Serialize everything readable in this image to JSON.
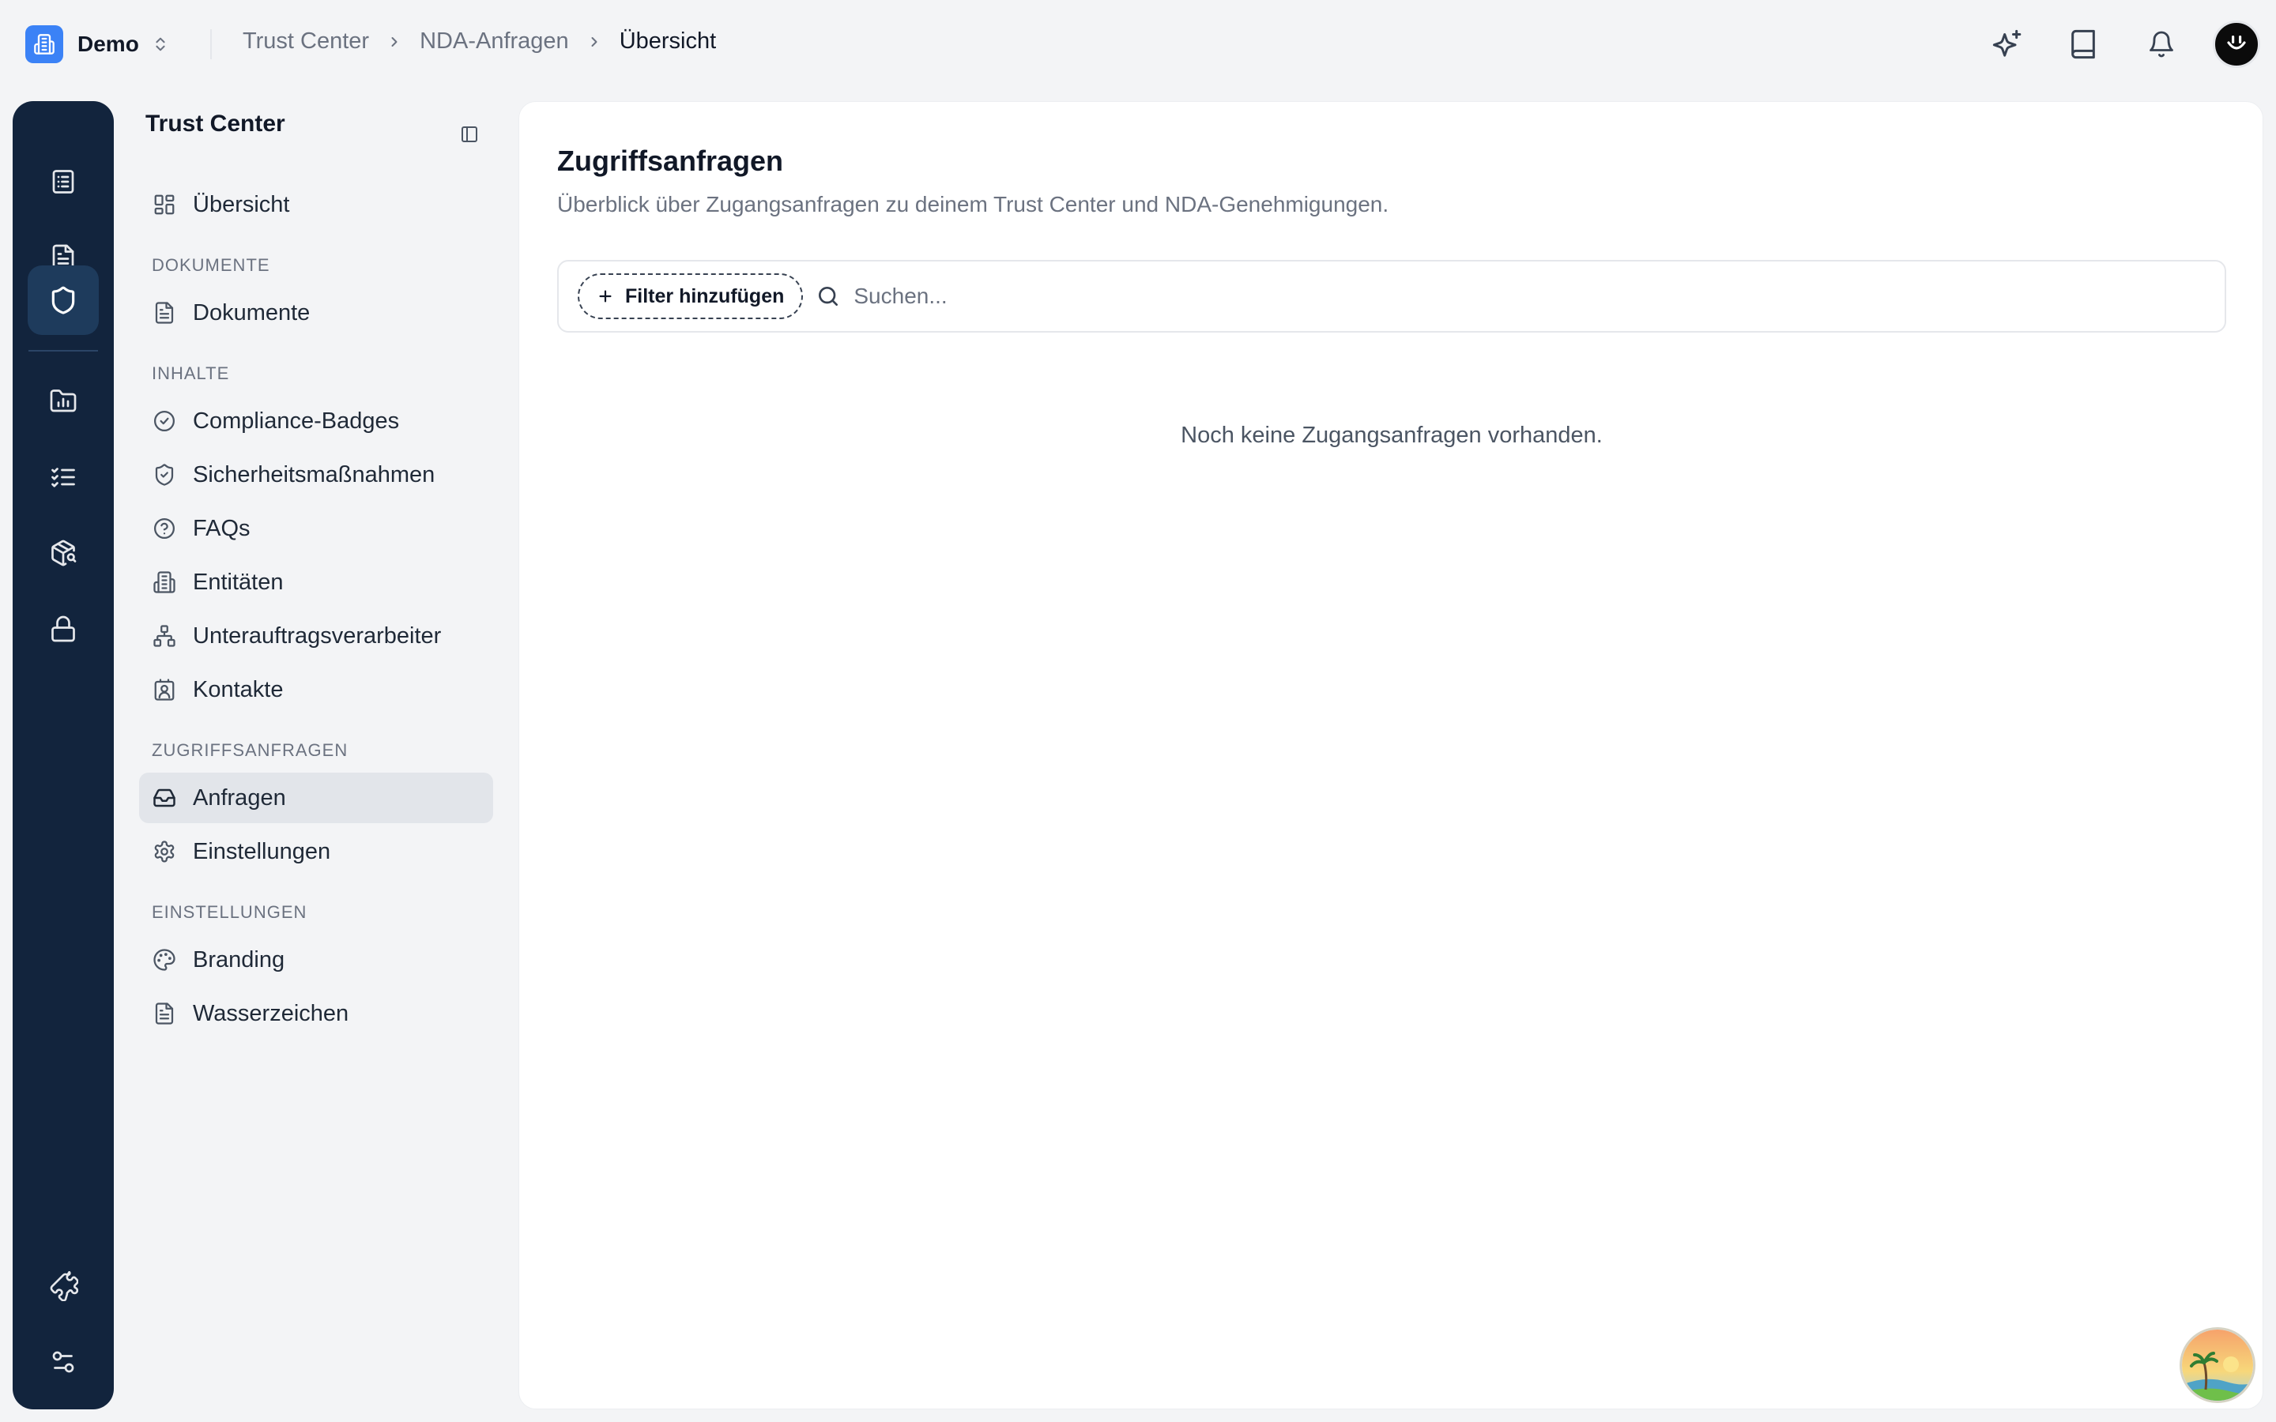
{
  "workspace": {
    "name": "Demo",
    "logo_icon": "building-icon",
    "switch_icon": "chevron-up-down-icon"
  },
  "breadcrumb": {
    "items": [
      "Trust Center",
      "NDA-Anfragen"
    ],
    "current": "Übersicht"
  },
  "topbar_icons": [
    "sparkles-icon",
    "book-icon",
    "bell-icon",
    "avatar"
  ],
  "rail": {
    "items": [
      "checklist-icon",
      "document-icon",
      "shield-icon",
      "chart-folder-icon",
      "tasks-icon",
      "package-search-icon",
      "lock-icon"
    ],
    "active": "shield-icon",
    "bottom_items": [
      "puzzle-icon",
      "sliders-icon"
    ]
  },
  "sidebar": {
    "title": "Trust Center",
    "overview": "Übersicht",
    "sections": {
      "documents": "DOKUMENTE",
      "contents": "INHALTE",
      "access": "ZUGRIFFSANFRAGEN",
      "settings": "EINSTELLUNGEN"
    },
    "items": {
      "documents": "Dokumente",
      "badges": "Compliance-Badges",
      "security": "Sicherheitsmaßnahmen",
      "faqs": "FAQs",
      "entities": "Entitäten",
      "subprocessors": "Unterauftragsverarbeiter",
      "contacts": "Kontakte",
      "requests": "Anfragen",
      "request_settings": "Einstellungen",
      "branding": "Branding",
      "watermark": "Wasserzeichen"
    },
    "active_item": "Anfragen"
  },
  "main": {
    "title": "Zugriffsanfragen",
    "subtitle": "Überblick über Zugangsanfragen zu deinem Trust Center und NDA-Genehmigungen.",
    "filter_label": "Filter hinzufügen",
    "search_placeholder": "Suchen...",
    "search_value": "",
    "empty_state": "Noch keine Zugangsanfragen vorhanden."
  },
  "colors": {
    "rail": "#12243d",
    "accent": "#3b82f6",
    "active_item_bg": "#e2e5ea"
  }
}
